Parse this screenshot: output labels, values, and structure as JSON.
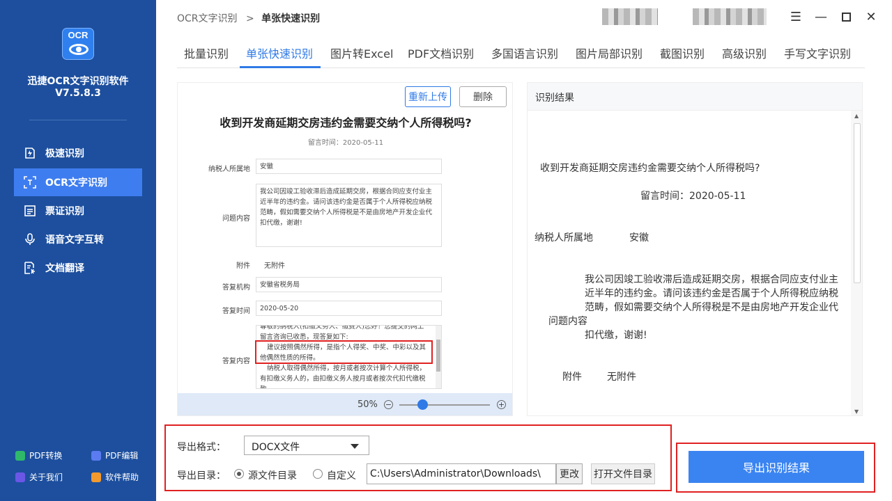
{
  "app": {
    "name": "迅捷OCR文字识别软件",
    "version": "V7.5.8.3",
    "logo_text": "OCR"
  },
  "sidebar": {
    "items": [
      {
        "label": "极速识别",
        "icon": "flash-doc-icon"
      },
      {
        "label": "OCR文字识别",
        "icon": "scan-text-icon",
        "active": true
      },
      {
        "label": "票证识别",
        "icon": "ticket-icon"
      },
      {
        "label": "语音文字互转",
        "icon": "microphone-icon"
      },
      {
        "label": "文档翻译",
        "icon": "translate-doc-icon"
      }
    ],
    "bottom": [
      {
        "label": "PDF转换",
        "color": "#2fb86a"
      },
      {
        "label": "PDF编辑",
        "color": "#5b7cf0"
      },
      {
        "label": "关于我们",
        "color": "#6b57e6"
      },
      {
        "label": "软件帮助",
        "color": "#f29a2e"
      }
    ]
  },
  "breadcrumb": {
    "parent": "OCR文字识别",
    "sep": ">",
    "current": "单张快速识别"
  },
  "tabs": [
    "批量识别",
    "单张快速识别",
    "图片转Excel",
    "PDF文档识别",
    "多国语言识别",
    "图片局部识别",
    "截图识别",
    "高级识别",
    "手写文字识别"
  ],
  "active_tab": "单张快速识别",
  "preview": {
    "reupload": "重新上传",
    "delete": "删除",
    "title": "收到开发商延期交房违约金需要交纳个人所得税吗?",
    "date": "留言时间：2020-05-11",
    "f1_label": "纳税人所属地",
    "f1_value": "安徽",
    "f2_label": "问题内容",
    "f2_line1": "我公司因竣工验收滞后造成延期交房，根据合同应支付业主",
    "f2_line2": "近半年的违约金。请问该违约金是否属于个人所得税应纳税",
    "f2_line3": "范畴，假如需要交纳个人所得税是不是由房地产开发企业代",
    "f2_line4": "扣代缴，谢谢!",
    "f3_label": "附件",
    "f3_value": "无附件",
    "f4_label": "答复机构",
    "f4_value": "安徽省税务局",
    "f5_label": "答复时间",
    "f5_value": "2020-05-20",
    "f6_label": "答复内容",
    "f6_line1": "尊敬的纳税人(扣缴义务人、缴费人)您好！您提交的网上",
    "f6_line2": "留言咨询已收悉，现答复如下:",
    "f6_line3": "建议按照偶然所得，是指个人得奖、中奖、中彩以及其",
    "f6_line4": "他偶然性质的所得。",
    "f6_line5": "纳税人取得偶然所得，按月或者按次计算个人所得税，",
    "f6_line6": "有扣缴义务人的，由扣缴义务人按月或者按次代扣代缴税",
    "f6_line7": "款。",
    "zoom": "50%",
    "zoom_level": 0.25
  },
  "result": {
    "header": "识别结果",
    "title": "收到开发商延期交房违约金需要交纳个人所得税吗?",
    "date": "留言时间：2020-05-11",
    "f1_label": "纳税人所属地",
    "f1_value": "安徽",
    "l1": "我公司因竣工验收滞后造成延期交房，根据合同应支付业主",
    "l2": "近半年的违约金。请问该违约金是否属于个人所得税应纳税",
    "l3": "范畴，假如需要交纳个人所得税是不是由房地产开发企业代",
    "l4_label": "问题内容",
    "l5": "扣代缴，谢谢!",
    "f3_label": "附件",
    "f3_value": "无附件"
  },
  "export": {
    "format_label": "导出格式：",
    "format_value": "DOCX文件",
    "dir_label": "导出目录：",
    "opt_source": "源文件目录",
    "opt_custom": "自定义",
    "path": "C:\\Users\\Administrator\\Downloads\\",
    "change": "更改",
    "open_dir": "打开文件目录",
    "export_btn": "导出识别结果"
  },
  "colors": {
    "sidebar": "#1d4f9e",
    "accent": "#2f7ae6",
    "highlight": "#e02020",
    "export_button": "#3a84f2"
  }
}
